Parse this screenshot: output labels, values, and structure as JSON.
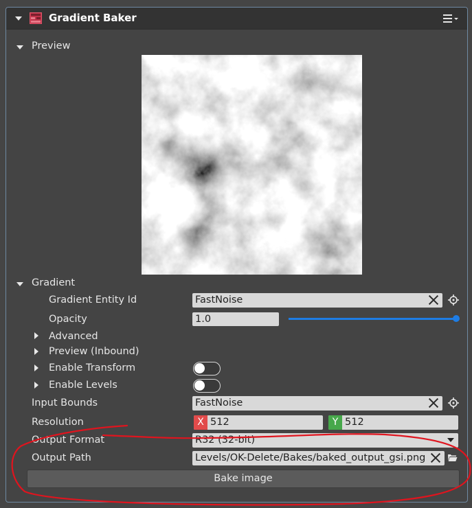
{
  "header": {
    "title": "Gradient Baker",
    "icon": "gradient-baker-icon",
    "menu_icon": "hamburger-menu-icon"
  },
  "preview_section": {
    "label": "Preview"
  },
  "gradient_section": {
    "label": "Gradient",
    "entity_id": {
      "label": "Gradient Entity Id",
      "value": "FastNoise"
    },
    "opacity": {
      "label": "Opacity",
      "value": "1.0",
      "slider_level": 1.0
    },
    "advanced_label": "Advanced",
    "preview_inbound_label": "Preview (Inbound)",
    "enable_transform_label": "Enable Transform",
    "enable_levels_label": "Enable Levels"
  },
  "input_bounds": {
    "label": "Input Bounds",
    "value": "FastNoise"
  },
  "resolution": {
    "label": "Resolution",
    "x_tag": "X",
    "x_value": "512",
    "y_tag": "Y",
    "y_value": "512"
  },
  "output_format": {
    "label": "Output Format",
    "value": "R32 (32-bit)"
  },
  "output_path": {
    "label": "Output Path",
    "value": "Levels/OK-Delete/Bakes/baked_output_gsi.png"
  },
  "bake_button": {
    "label": "Bake image"
  },
  "colors": {
    "accent": "#1e7de5",
    "x_tag": "#e24b4b",
    "y_tag": "#47a84b",
    "annotation": "#e0141e",
    "panel_border": "#6f8aa3"
  }
}
